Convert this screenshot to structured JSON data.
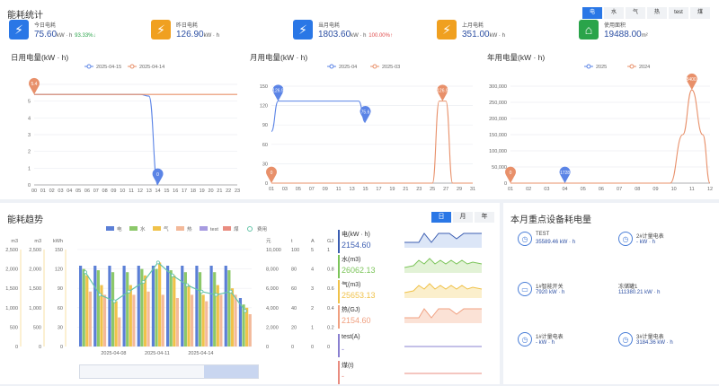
{
  "top": {
    "title": "能耗统计",
    "kpis": [
      {
        "label": "今日电耗",
        "value": "75.60",
        "unit": "kW · h",
        "change": "93.33%",
        "dir": "down",
        "icon": "bolt-icon",
        "color": "#2a77e6"
      },
      {
        "label": "昨日电耗",
        "value": "126.90",
        "unit": "kW · h",
        "change": "",
        "dir": "",
        "icon": "bolt-icon",
        "color": "#f0a020"
      },
      {
        "label": "当月电耗",
        "value": "1803.60",
        "unit": "kW · h",
        "change": "100.00%",
        "dir": "up",
        "icon": "bolt-icon",
        "color": "#2a77e6"
      },
      {
        "label": "上月电耗",
        "value": "351.00",
        "unit": "kW · h",
        "change": "",
        "dir": "",
        "icon": "bolt-icon",
        "color": "#f0a020"
      },
      {
        "label": "使用面积",
        "value": "19488.00",
        "unit": "m²",
        "change": "",
        "dir": "",
        "icon": "house-icon",
        "color": "#2aa44a"
      }
    ],
    "energy_tabs": [
      "电",
      "水",
      "气",
      "热",
      "test",
      "煤"
    ],
    "energy_tab_active": 0
  },
  "chart_data": [
    {
      "type": "line",
      "title": "日用电量(kW · h)",
      "series": [
        {
          "name": "2025-04-15",
          "color": "#5b84e6",
          "values": [
            5.4,
            5.4,
            5.4,
            5.4,
            5.4,
            5.4,
            5.4,
            5.4,
            5.4,
            5.4,
            5.4,
            5.4,
            5.4,
            5.3,
            0.0
          ]
        },
        {
          "name": "2025-04-14",
          "color": "#e8906a",
          "values": [
            5.4,
            5.4,
            5.4,
            5.4,
            5.4,
            5.4,
            5.4,
            5.4,
            5.4,
            5.4,
            5.4,
            5.4,
            5.4,
            5.4,
            5.4,
            5.4,
            5.4,
            5.4,
            5.4,
            5.4,
            5.4,
            5.4,
            5.4,
            5.4
          ]
        }
      ],
      "x": [
        "00",
        "01",
        "02",
        "03",
        "04",
        "05",
        "06",
        "07",
        "08",
        "09",
        "10",
        "11",
        "12",
        "13",
        "14",
        "15",
        "16",
        "17",
        "18",
        "19",
        "20",
        "21",
        "22",
        "23"
      ],
      "ylim": [
        0,
        6
      ],
      "yticks": [
        "0",
        "1",
        "2",
        "3",
        "4",
        "5",
        ""
      ],
      "markers": [
        {
          "label": "5.4",
          "series": 1,
          "x": 0,
          "y": 5.4
        },
        {
          "label": "0",
          "series": 0,
          "x": 14,
          "y": 0
        }
      ]
    },
    {
      "type": "line",
      "title": "月用电量(kW · h)",
      "series": [
        {
          "name": "2025-04",
          "color": "#5b84e6",
          "points": [
            [
              1,
              80
            ],
            [
              2,
              126.9
            ],
            [
              14,
              126.9
            ],
            [
              15,
              94
            ]
          ]
        },
        {
          "name": "2025-03",
          "color": "#e8906a",
          "points": [
            [
              1,
              0
            ],
            [
              25,
              0
            ],
            [
              26,
              126.9
            ],
            [
              27,
              126.9
            ],
            [
              28,
              0
            ],
            [
              31,
              0
            ]
          ]
        }
      ],
      "x": [
        "01",
        "03",
        "05",
        "07",
        "09",
        "11",
        "13",
        "15",
        "17",
        "19",
        "21",
        "23",
        "25",
        "27",
        "29",
        "31"
      ],
      "xmin": 1,
      "xmax": 31,
      "ylim": [
        0,
        150
      ],
      "yticks": [
        "0",
        "30",
        "60",
        "90",
        "120",
        "150"
      ],
      "markers": [
        {
          "label": "126.9",
          "series": 0,
          "x": 2,
          "y": 126.9
        },
        {
          "label": "75.6",
          "series": 0,
          "x": 15,
          "y": 94
        },
        {
          "label": "0",
          "series": 1,
          "x": 1,
          "y": 0
        },
        {
          "label": "126.9",
          "series": 1,
          "x": 26.5,
          "y": 126.9
        }
      ]
    },
    {
      "type": "line",
      "title": "年用电量(kW · h)",
      "series": [
        {
          "name": "2025",
          "color": "#5b84e6",
          "points": [
            [
              1,
              0
            ],
            [
              4,
              0
            ]
          ]
        },
        {
          "name": "2024",
          "color": "#e8906a",
          "points": [
            [
              1,
              0
            ],
            [
              9.8,
              0
            ],
            [
              10.5,
              150000
            ],
            [
              11,
              288400
            ],
            [
              11.6,
              150000
            ],
            [
              12,
              0
            ]
          ]
        }
      ],
      "x": [
        "01",
        "02",
        "03",
        "04",
        "05",
        "06",
        "07",
        "08",
        "09",
        "10",
        "11",
        "12"
      ],
      "xmin": 1,
      "xmax": 12,
      "ylim": [
        0,
        300000
      ],
      "yticks": [
        "0",
        "50,000",
        "100,000",
        "150,000",
        "200,000",
        "250,000",
        "300,000"
      ],
      "markers": [
        {
          "label": "0",
          "series": 1,
          "x": 1,
          "y": 0
        },
        {
          "label": "1728",
          "series": 0,
          "x": 4,
          "y": 0
        },
        {
          "label": "288400.12",
          "series": 1,
          "x": 11,
          "y": 288400
        }
      ]
    },
    {
      "type": "bar",
      "title": "能耗趋势",
      "legend": [
        "电",
        "水",
        "气",
        "热",
        "test",
        "煤",
        "费用"
      ],
      "colors": [
        "#5b7fd6",
        "#8cc86a",
        "#f0c24a",
        "#f3b99a",
        "#a79be0",
        "#e98c80",
        "#63c4a8"
      ],
      "x_labels": [
        "2025-04-08",
        "2025-04-11",
        "2025-04-14"
      ],
      "left_axes": [
        {
          "unit": "m3",
          "ticks": [
            "0",
            "500",
            "1,000",
            "1,500",
            "2,000",
            "2,500"
          ]
        },
        {
          "unit": "m3",
          "ticks": [
            "0",
            "500",
            "1,000",
            "1,500",
            "2,000",
            "2,500"
          ]
        },
        {
          "unit": "kWh",
          "ticks": [
            "0",
            "30",
            "60",
            "90",
            "120",
            "150"
          ]
        }
      ],
      "right_axes": [
        {
          "unit": "元",
          "ticks": [
            "0",
            "2,000",
            "4,000",
            "6,000",
            "8,000",
            "10,000"
          ]
        },
        {
          "unit": "t",
          "ticks": [
            "0",
            "20",
            "40",
            "60",
            "80",
            "100"
          ]
        },
        {
          "unit": "A",
          "ticks": [
            "0",
            "1",
            "2",
            "3",
            "4",
            "5"
          ]
        },
        {
          "unit": "GJ",
          "ticks": [
            "0",
            "0.2",
            "0.4",
            "0.6",
            "0.8",
            "1"
          ]
        }
      ],
      "groups": [
        {
          "elec": 125,
          "water": 120,
          "gas": 110,
          "heat": 85,
          "test": 120,
          "coal": 120,
          "fee": 115
        },
        {
          "elec": 125,
          "water": 118,
          "gas": 95,
          "heat": 80,
          "test": 120,
          "coal": 118,
          "fee": 80
        },
        {
          "elec": 125,
          "water": 115,
          "gas": 70,
          "heat": 45,
          "test": 120,
          "coal": 118,
          "fee": 70
        },
        {
          "elec": 125,
          "water": 115,
          "gas": 95,
          "heat": 80,
          "test": 120,
          "coal": 118,
          "fee": 85
        },
        {
          "elec": 125,
          "water": 120,
          "gas": 110,
          "heat": 85,
          "test": 120,
          "coal": 120,
          "fee": 100
        },
        {
          "elec": 125,
          "water": 120,
          "gas": 130,
          "heat": 80,
          "test": 120,
          "coal": 120,
          "fee": 130
        },
        {
          "elec": 125,
          "water": 118,
          "gas": 110,
          "heat": 75,
          "test": 120,
          "coal": 118,
          "fee": 110
        },
        {
          "elec": 125,
          "water": 115,
          "gas": 95,
          "heat": 80,
          "test": 120,
          "coal": 115,
          "fee": 95
        },
        {
          "elec": 125,
          "water": 115,
          "gas": 80,
          "heat": 70,
          "test": 120,
          "coal": 115,
          "fee": 85
        },
        {
          "elec": 125,
          "water": 115,
          "gas": 95,
          "heat": 80,
          "test": 120,
          "coal": 115,
          "fee": 80
        },
        {
          "elec": 125,
          "water": 118,
          "gas": 90,
          "heat": 80,
          "test": 120,
          "coal": 115,
          "fee": 85
        },
        {
          "elec": 75,
          "water": 65,
          "gas": 60,
          "heat": 50,
          "test": 75,
          "coal": 70,
          "fee": 55
        }
      ]
    }
  ],
  "trend": {
    "time_tabs": [
      "日",
      "月",
      "年"
    ],
    "time_tab_active": 0,
    "spark": [
      {
        "label": "电(kW · h)",
        "value": "2154.60",
        "color": "#3b5db1",
        "fill": "#dce6f7"
      },
      {
        "label": "水(m3)",
        "value": "26062.13",
        "color": "#7cc45a",
        "fill": "#e2f2d6"
      },
      {
        "label": "气(m3)",
        "value": "25653.13",
        "color": "#f0c24a",
        "fill": "#fbefcc"
      },
      {
        "label": "热(GJ)",
        "value": "2154.60",
        "color": "#f0a080",
        "fill": "#fbe2d6"
      },
      {
        "label": "test(A)",
        "value": "-",
        "color": "#8a80d0",
        "fill": ""
      },
      {
        "label": "煤(t)",
        "value": "-",
        "color": "#e98c80",
        "fill": ""
      }
    ]
  },
  "devices": {
    "title": "本月重点设备耗电量",
    "items": [
      {
        "name": "TEST",
        "value": "35589.46 kW · h",
        "icon": "meter-icon"
      },
      {
        "name": "2#计量电表",
        "value": "- kW · h",
        "icon": "meter-icon"
      },
      {
        "name": "1#智能开关",
        "value": "7920 kW · h",
        "icon": "switch-icon"
      },
      {
        "name": "冻储罐1",
        "value": "111380.21 kW · h",
        "icon": "tank-icon"
      },
      {
        "name": "1#计量电表",
        "value": "- kW · h",
        "icon": "meter-icon"
      },
      {
        "name": "3#计量电表",
        "value": "3184.36 kW · h",
        "icon": "meter-icon"
      }
    ]
  }
}
